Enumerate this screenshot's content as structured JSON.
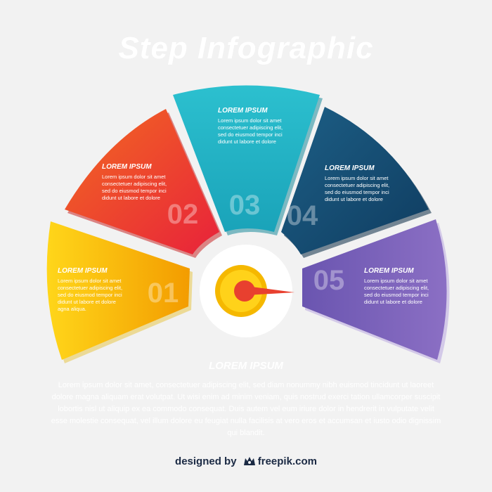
{
  "title": "Step Infographic",
  "steps": [
    {
      "number": "01",
      "heading": "LOREM IPSUM",
      "body": [
        "Lorem ipsum dolor sit amet",
        "consectetuer adipiscing elit,",
        "sed do eiusmod tempor inci",
        "didunt ut labore et dolore",
        "agna aliqua."
      ],
      "color": "#f5b800"
    },
    {
      "number": "02",
      "heading": "LOREM IPSUM",
      "body": [
        "Lorem ipsum dolor sit amet",
        "consectetuer adipiscing elit,",
        "sed do eiusmod tempor inci",
        "didunt ut labore et dolore"
      ],
      "color": "#e8402f"
    },
    {
      "number": "03",
      "heading": "LOREM IPSUM",
      "body": [
        "Lorem ipsum dolor sit amet",
        "consectetuer adipiscing elit,",
        "sed do eiusmod tempor inci",
        "didunt ut labore et dolore"
      ],
      "color": "#22afc4"
    },
    {
      "number": "04",
      "heading": "LOREM IPSUM",
      "body": [
        "Lorem ipsum dolor sit amet",
        "consectetuer adipiscing elit,",
        "sed do eiusmod tempor inci",
        "didunt ut labore et dolore"
      ],
      "color": "#164d74"
    },
    {
      "number": "05",
      "heading": "LOREM IPSUM",
      "body": [
        "Lorem ipsum dolor sit amet",
        "consectetuer adipiscing elit,",
        "sed do eiusmod tempor inci",
        "didunt ut labore et dolore"
      ],
      "color": "#7b5cb5"
    }
  ],
  "bottom": {
    "heading": "LOREM IPSUM",
    "body": "Lorem ipsum dolor sit amet, consectetuer adipiscing elit, sed diam nonummy nibh euismod tincidunt ut laoreet dolore magna aliquam erat volutpat. Ut wisi enim ad minim veniam, quis nostrud exerci tation ullamcorper suscipit lobortis nisl ut aliquip ex ea commodo consequat. Duis autem vel eum iriure dolor in hendrerit in vulputate velit esse molestie consequat, vel illum dolore eu feugiat nulla facilisis at vero eros et accumsan et iusto odio dignissim qui blandit."
  },
  "credit": {
    "prefix": "designed by",
    "brand": "freepik.com",
    "icon": "freepik-logo-icon"
  },
  "gauge": {
    "hub_color": "#f5b800",
    "needle_color": "#e8402f",
    "icon": "gauge-needle-icon"
  }
}
